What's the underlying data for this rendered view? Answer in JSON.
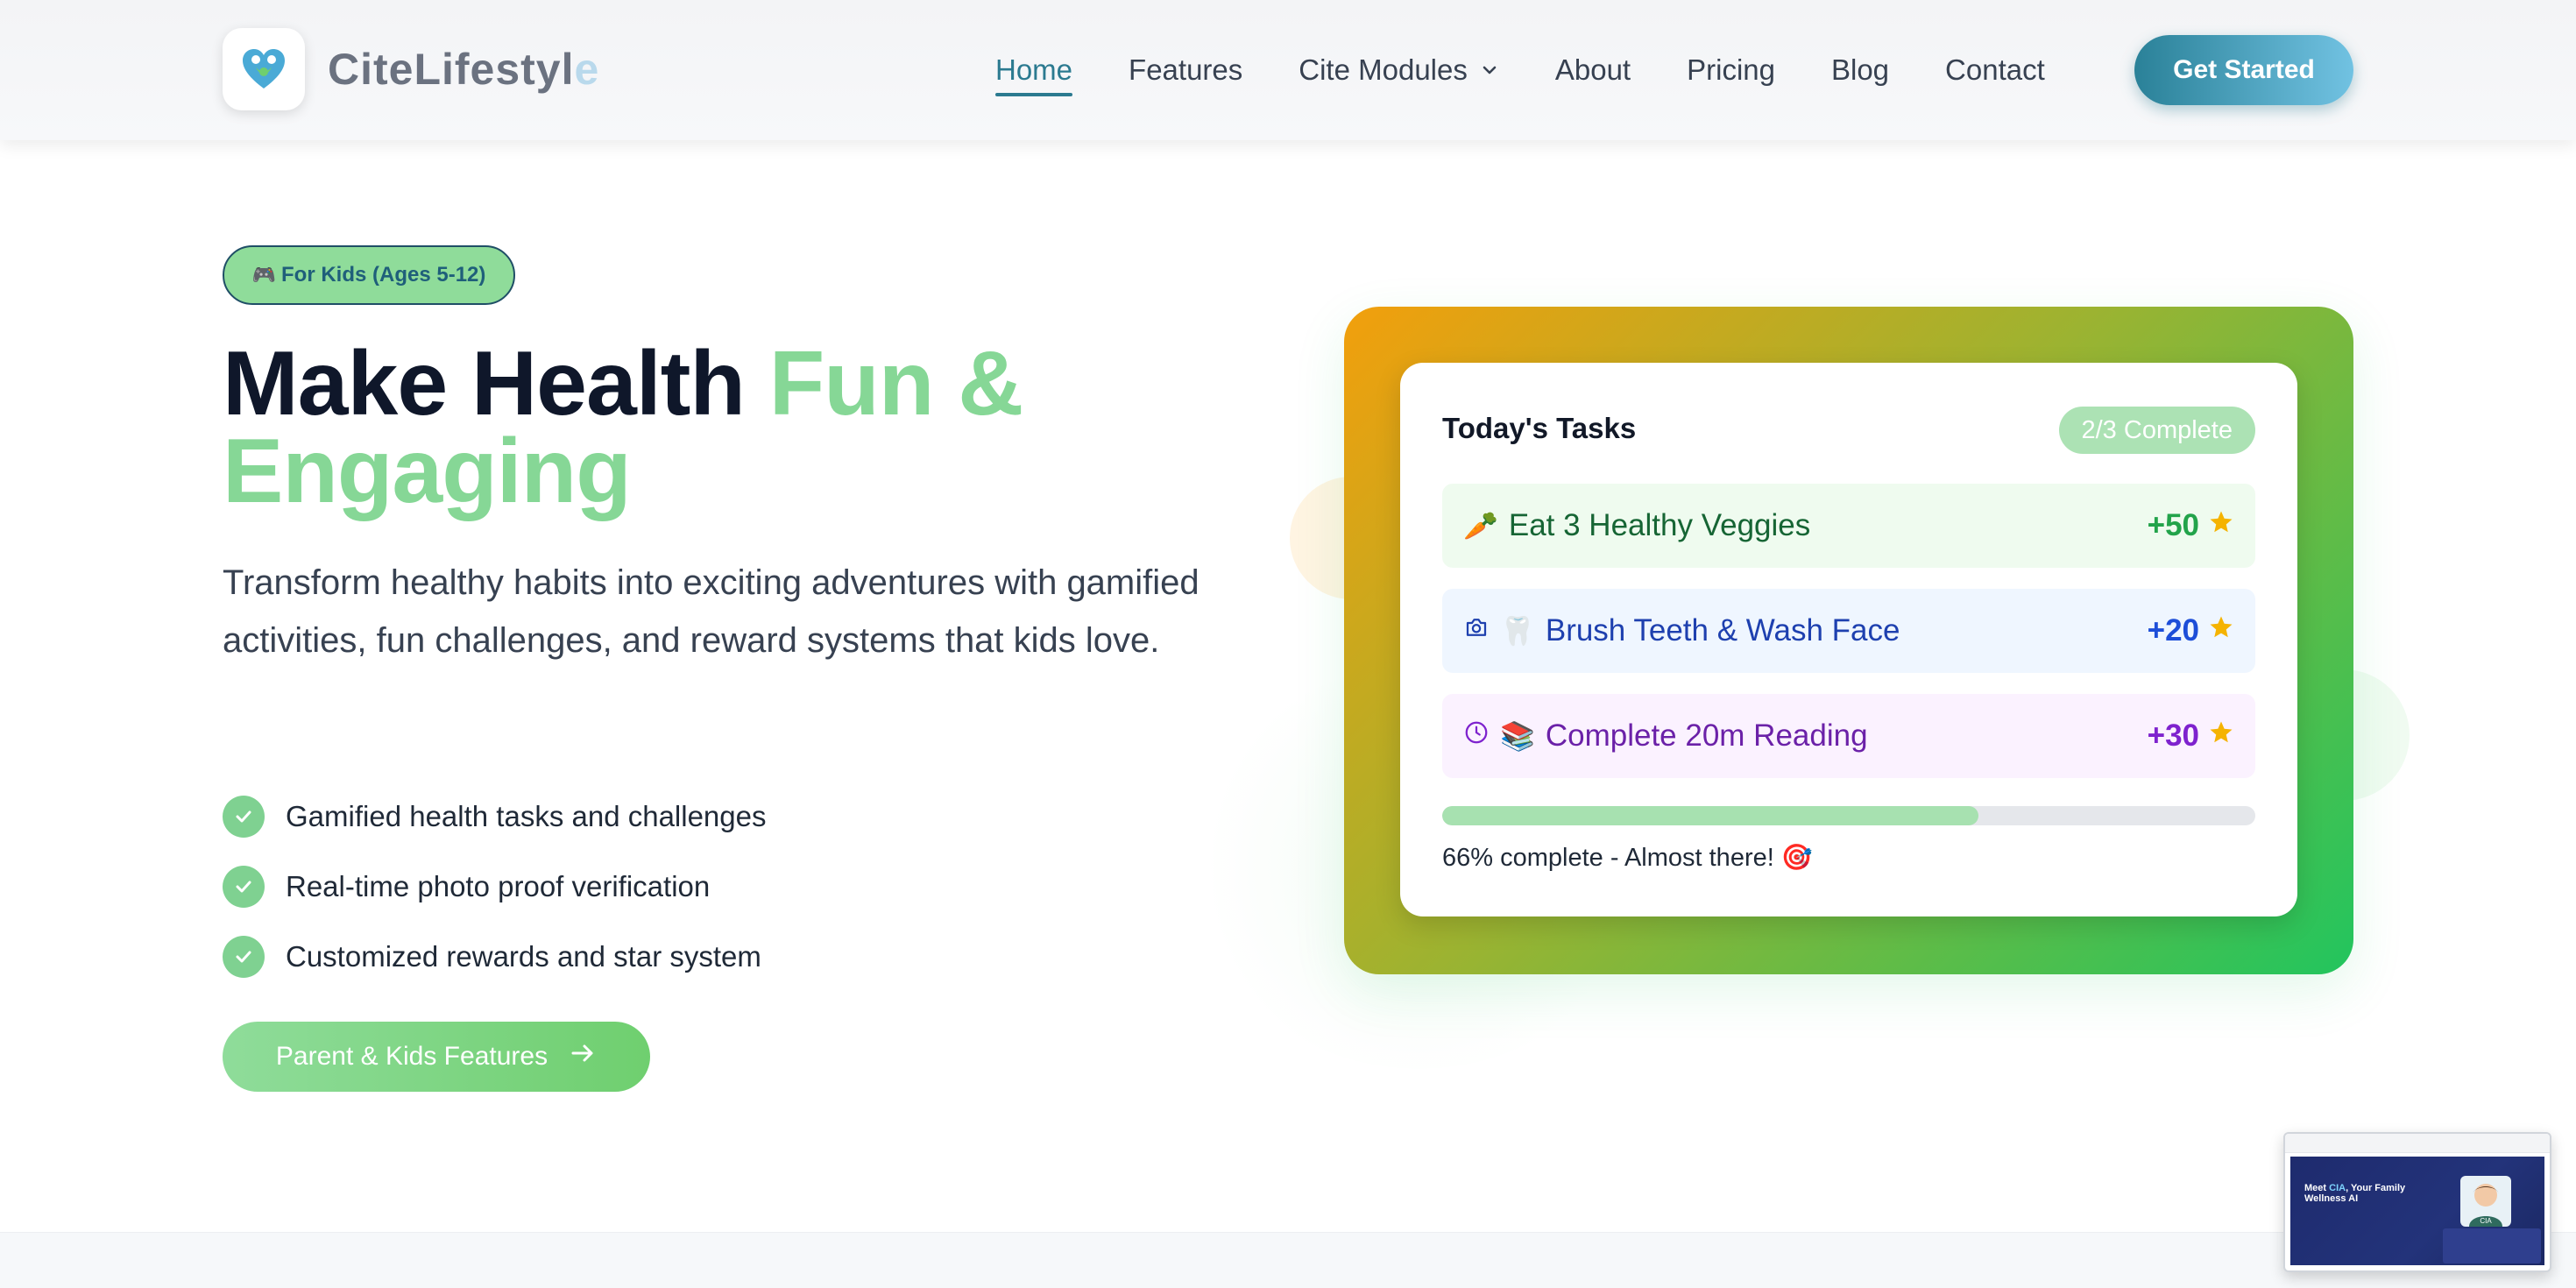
{
  "brand": {
    "name_main": "CiteL",
    "name_accent": "ifestyl",
    "name_fade": "e",
    "colors": {
      "primary": "#2b7a90",
      "green": "#86d796",
      "heart_blue": "#42a6d6",
      "heart_green": "#6fcf6f"
    }
  },
  "nav": {
    "items": [
      {
        "label": "Home",
        "active": true
      },
      {
        "label": "Features"
      },
      {
        "label": "Cite Modules",
        "icon": "chevron-down-icon"
      },
      {
        "label": "About"
      },
      {
        "label": "Pricing"
      },
      {
        "label": "Blog"
      },
      {
        "label": "Contact"
      }
    ],
    "cta": "Get Started"
  },
  "hero": {
    "badge_icon": "🎮",
    "badge": "For Kids (Ages 5-12)",
    "title_plain": "Make Health ",
    "title_highlight": "Fun & Engaging",
    "subtitle": "Transform healthy habits into exciting adventures with gamified activities, fun challenges, and reward systems that kids love.",
    "features": [
      "Gamified health tasks and challenges",
      "Real-time photo proof verification",
      "Customized rewards and star system"
    ],
    "cta": "Parent & Kids Features"
  },
  "tasks_card": {
    "title": "Today's Tasks",
    "status": "2/3 Complete",
    "tasks": [
      {
        "icon": "carrot-emoji",
        "emoji": "🥕",
        "label": "Eat 3 Healthy Veggies",
        "points": "+50",
        "color": "#22a34a"
      },
      {
        "icon": "camera-icon",
        "emoji": "🦷",
        "label": "Brush Teeth & Wash Face",
        "points": "+20",
        "color": "#1d4ed8"
      },
      {
        "icon": "clock-icon",
        "emoji": "📚",
        "label": "Complete 20m Reading",
        "points": "+30",
        "color": "#7e22ce"
      }
    ],
    "progress": 0.66,
    "progress_text": "66% complete - Almost there! 🎯"
  },
  "preview_thumbnail": {
    "title_a": "Meet ",
    "title_acc": "CIA",
    "title_b": ", Your Family Wellness AI",
    "avatar_label": "CIA"
  }
}
